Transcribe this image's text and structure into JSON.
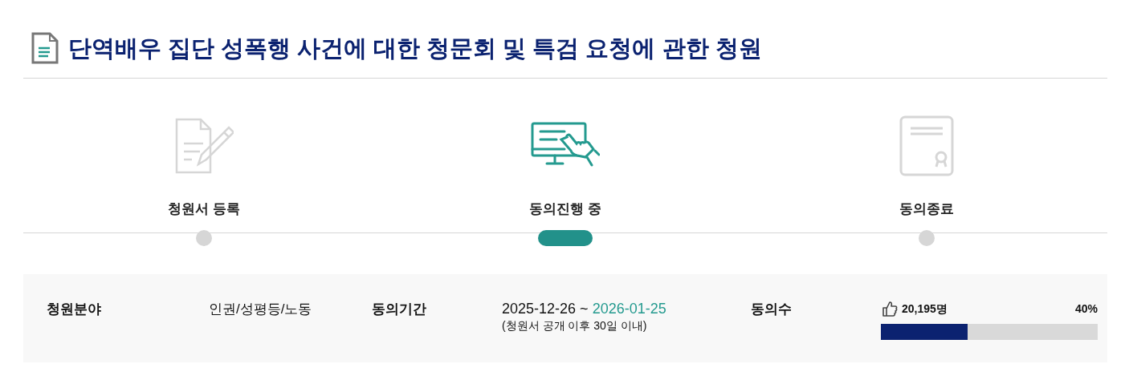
{
  "title": "단역배우 집단 성폭행 사건에 대한 청문회 및 특검 요청에 관한 청원",
  "steps": [
    {
      "label": "청원서 등록",
      "kind": "register",
      "selected": false
    },
    {
      "label": "동의진행 중",
      "kind": "progress",
      "selected": true
    },
    {
      "label": "동의종료",
      "kind": "closed",
      "selected": false
    }
  ],
  "info": {
    "category_label": "청원분야",
    "category": "인권/성평등/노동",
    "period_label": "동의기간",
    "period_start": "2025-12-26",
    "period_sep": "~",
    "period_end": "2026-01-25",
    "period_note": "(청원서 공개 이후 30일 이내)",
    "count_label": "동의수",
    "count": "20,195명",
    "percent": "40%",
    "level": 0.4
  }
}
